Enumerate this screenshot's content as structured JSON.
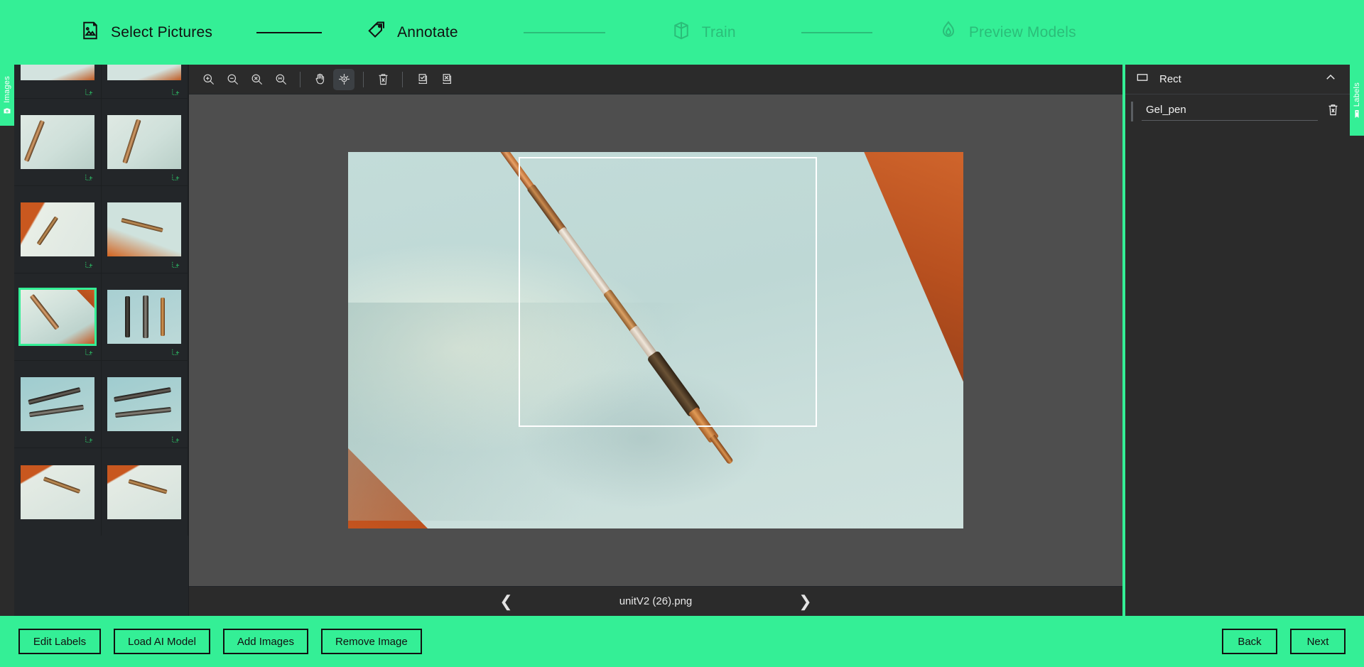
{
  "wizard": {
    "steps": [
      {
        "label": "Select Pictures",
        "icon": "pictures-icon",
        "state": "active"
      },
      {
        "label": "Annotate",
        "icon": "tag-icon",
        "state": "active"
      },
      {
        "label": "Train",
        "icon": "cube-icon",
        "state": "inactive"
      },
      {
        "label": "Preview Models",
        "icon": "flame-icon",
        "state": "inactive"
      }
    ]
  },
  "left_rail": {
    "label": "Images",
    "icon": "camera-icon"
  },
  "right_rail": {
    "label": "Labels",
    "icon": "tag-icon"
  },
  "toolbar": {
    "buttons": [
      {
        "name": "zoom-in-icon",
        "title": "Zoom In",
        "active": false
      },
      {
        "name": "zoom-out-icon",
        "title": "Zoom Out",
        "active": false
      },
      {
        "name": "zoom-fit-icon",
        "title": "Fit to Window",
        "active": false
      },
      {
        "name": "zoom-actual-icon",
        "title": "Actual Size 1:1",
        "active": false
      },
      {
        "name": "pan-hand-icon",
        "title": "Pan",
        "active": false
      },
      {
        "name": "crosshair-icon",
        "title": "Draw Rect",
        "active": true
      },
      {
        "name": "delete-icon",
        "title": "Delete",
        "active": false
      },
      {
        "name": "check-all-icon",
        "title": "Select All",
        "active": false
      },
      {
        "name": "uncheck-all-icon",
        "title": "Deselect All",
        "active": false
      }
    ]
  },
  "thumbnails": {
    "items": [
      {
        "id": 1,
        "selected": false,
        "has_annotation": true
      },
      {
        "id": 2,
        "selected": false,
        "has_annotation": true
      },
      {
        "id": 3,
        "selected": false,
        "has_annotation": true
      },
      {
        "id": 4,
        "selected": false,
        "has_annotation": true
      },
      {
        "id": 5,
        "selected": false,
        "has_annotation": true
      },
      {
        "id": 6,
        "selected": false,
        "has_annotation": true
      },
      {
        "id": 7,
        "selected": true,
        "has_annotation": true
      },
      {
        "id": 8,
        "selected": false,
        "has_annotation": true
      },
      {
        "id": 9,
        "selected": false,
        "has_annotation": true
      },
      {
        "id": 10,
        "selected": false,
        "has_annotation": true
      },
      {
        "id": 11,
        "selected": false,
        "has_annotation": false
      },
      {
        "id": 12,
        "selected": false,
        "has_annotation": false
      }
    ]
  },
  "canvas": {
    "filename": "unitV2 (26).png",
    "prev_icon": "chevron-left-icon",
    "next_icon": "chevron-right-icon",
    "annotation_box_color": "#ffffff"
  },
  "labels_panel": {
    "shape_type": "Rect",
    "shape_icon": "rectangle-icon",
    "collapse_icon": "chevron-up-icon",
    "label_value": "Gel_pen",
    "delete_icon": "delete-icon"
  },
  "footer": {
    "left_buttons": [
      {
        "label": "Edit Labels",
        "name": "edit-labels-button"
      },
      {
        "label": "Load AI Model",
        "name": "load-ai-model-button"
      },
      {
        "label": "Add Images",
        "name": "add-images-button"
      },
      {
        "label": "Remove Image",
        "name": "remove-image-button"
      }
    ],
    "right_buttons": [
      {
        "label": "Back",
        "name": "back-button"
      },
      {
        "label": "Next",
        "name": "next-button"
      }
    ]
  },
  "colors": {
    "accent": "#34ef96",
    "panel": "#2b2b2b",
    "thumb_panel": "#232629",
    "canvas_bg": "#4e4e4e"
  }
}
